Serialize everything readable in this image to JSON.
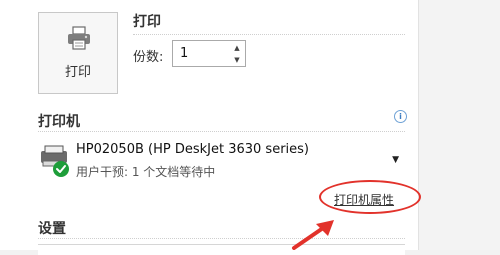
{
  "print_section": {
    "heading": "打印",
    "print_button_label": "打印",
    "copies_label": "份数:",
    "copies_value": "1"
  },
  "printer_section": {
    "heading": "打印机",
    "printer_name": "HP02050B (HP DeskJet 3630 series)",
    "printer_status": "用户干预: 1 个文档等待中",
    "properties_link": "打印机属性"
  },
  "settings_section": {
    "heading": "设置"
  },
  "colors": {
    "highlight": "#e2322b",
    "info": "#3d7cc0"
  },
  "icons": [
    "printer-icon",
    "info-icon",
    "printer-status-icon",
    "check-icon",
    "chevron-down-icon",
    "arrow-icon"
  ]
}
